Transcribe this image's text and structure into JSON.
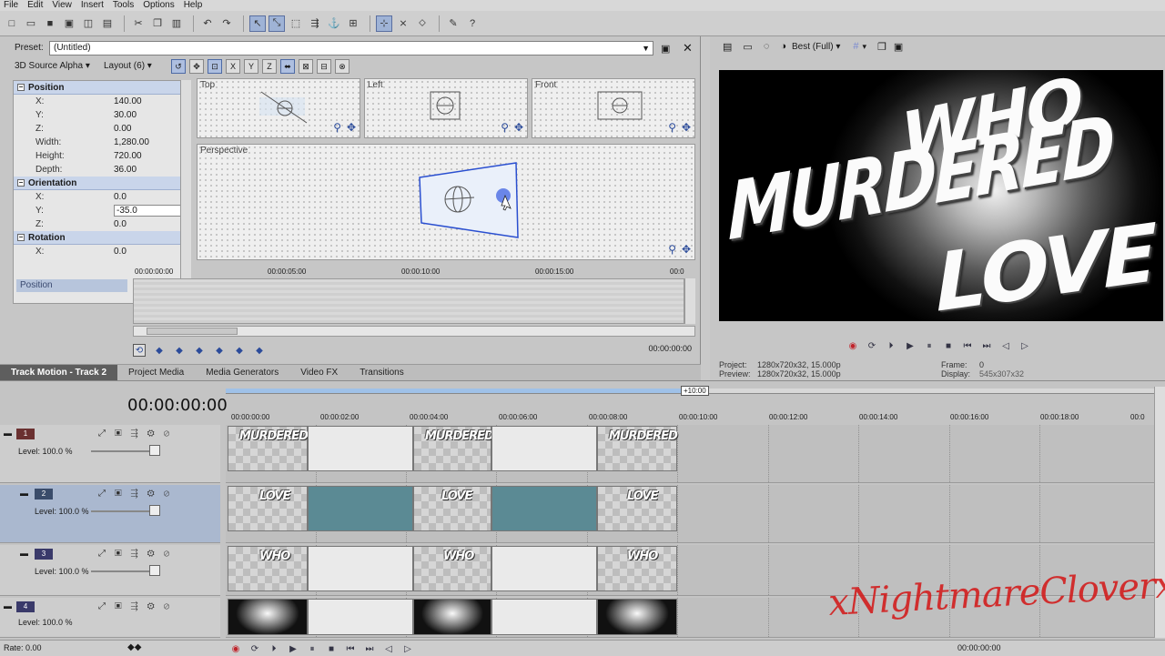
{
  "menu": [
    "File",
    "Edit",
    "View",
    "Insert",
    "Tools",
    "Options",
    "Help"
  ],
  "track_motion": {
    "preset_label": "Preset:",
    "preset_value": "(Untitled)",
    "mode_label": "3D Source Alpha",
    "layout_label": "Layout (6)",
    "position_head": "Position",
    "orientation_head": "Orientation",
    "rotation_head": "Rotation",
    "position": [
      {
        "k": "X:",
        "v": "140.00"
      },
      {
        "k": "Y:",
        "v": "30.00"
      },
      {
        "k": "Z:",
        "v": "0.00"
      },
      {
        "k": "Width:",
        "v": "1,280.00"
      },
      {
        "k": "Height:",
        "v": "720.00"
      },
      {
        "k": "Depth:",
        "v": "36.00"
      }
    ],
    "orientation": [
      {
        "k": "X:",
        "v": "0.0"
      },
      {
        "k": "Y:",
        "v": "-35.0"
      },
      {
        "k": "Z:",
        "v": "0.0"
      }
    ],
    "rotation_partial": {
      "k": "X:",
      "v": "0.0"
    },
    "views": {
      "top": "Top",
      "left": "Left",
      "front": "Front",
      "perspective": "Perspective"
    },
    "kf_track_label": "Position",
    "kf_ruler": [
      "00:00:00:00",
      "00:00:05:00",
      "00:00:10:00",
      "00:00:15:00",
      "00:0"
    ],
    "kf_time": "00:00:00:00",
    "tabs": [
      "Track Motion - Track 2",
      "Project Media",
      "Media Generators",
      "Video FX",
      "Transitions"
    ]
  },
  "preview": {
    "quality": "Best (Full)",
    "words": [
      "WHO",
      "MURDERED",
      "LOVE"
    ],
    "project_label": "Project:",
    "project_value": "1280x720x32, 15.000p",
    "preview_label": "Preview:",
    "preview_value": "1280x720x32, 15.000p",
    "frame_label": "Frame:",
    "frame_value": "0",
    "display_label": "Display:",
    "display_value": "545x307x32"
  },
  "timeline": {
    "counter": "00:00:00:00",
    "loop_tag": "+10:00",
    "ruler": [
      "00:00:00:00",
      "00:00:02:00",
      "00:00:04:00",
      "00:00:06:00",
      "00:00:08:00",
      "00:00:10:00",
      "00:00:12:00",
      "00:00:14:00",
      "00:00:16:00",
      "00:00:18:00",
      "00:0"
    ],
    "tracks": [
      {
        "num": "1",
        "level": "Level: 100.0 %",
        "clip_text": "MURDERED"
      },
      {
        "num": "2",
        "level": "Level: 100.0 %",
        "clip_text": "LOVE"
      },
      {
        "num": "3",
        "level": "Level: 100.0 %",
        "clip_text": "WHO"
      },
      {
        "num": "4",
        "level": "Level: 100.0 %",
        "clip_text": ""
      }
    ],
    "rate": "Rate: 0.00",
    "time_readout": "00:00:00:00"
  },
  "watermark": "xNightmareCloverx",
  "colors": {
    "accent": "#9fb3d6",
    "teal_clip": "#5b8a94",
    "record": "#c0242b"
  }
}
